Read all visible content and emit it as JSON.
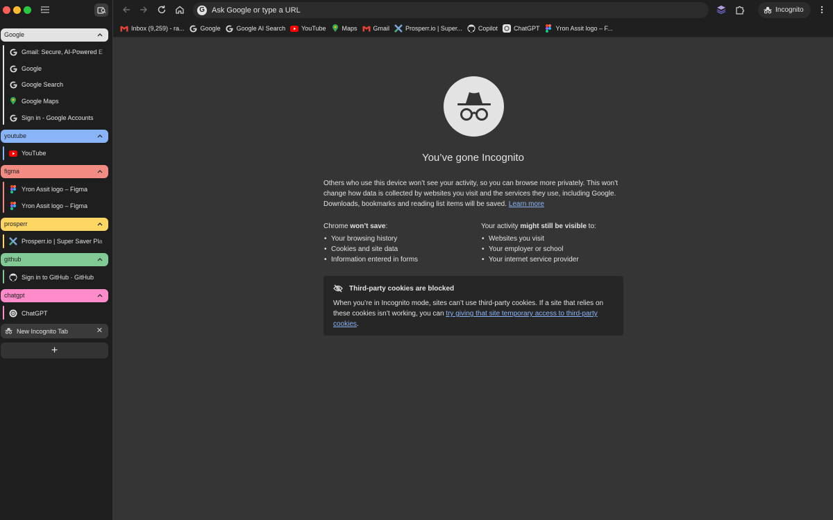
{
  "sidebar": {
    "groups": [
      {
        "label": "Google",
        "color": "#e3e3e3",
        "tabs": [
          {
            "title": "Gmail: Secure, AI-Powered E",
            "icon": "google-icon"
          },
          {
            "title": "Google",
            "icon": "google-icon"
          },
          {
            "title": "Google Search",
            "icon": "google-icon"
          },
          {
            "title": "Google Maps",
            "icon": "maps-icon"
          },
          {
            "title": "Sign in - Google Accounts",
            "icon": "google-icon"
          }
        ]
      },
      {
        "label": "youtube",
        "color": "#8ab4f8",
        "tabs": [
          {
            "title": "YouTube",
            "icon": "youtube-icon"
          }
        ]
      },
      {
        "label": "figma",
        "color": "#f28b82",
        "tabs": [
          {
            "title": "Yron Assit logo – Figma",
            "icon": "figma-icon"
          },
          {
            "title": "Yron Assit logo – Figma",
            "icon": "figma-icon"
          }
        ]
      },
      {
        "label": "prosperr",
        "color": "#fdd663",
        "tabs": [
          {
            "title": "Prosperr.io | Super Saver Pla",
            "icon": "prosperr-icon"
          }
        ]
      },
      {
        "label": "github",
        "color": "#81c995",
        "tabs": [
          {
            "title": "Sign in to GitHub · GitHub",
            "icon": "github-icon"
          }
        ]
      },
      {
        "label": "chatgpt",
        "color": "#ff8bcb",
        "tabs": [
          {
            "title": "ChatGPT",
            "icon": "chatgpt-icon"
          }
        ]
      }
    ],
    "active_tab": {
      "title": "New Incognito Tab",
      "close": "✕"
    },
    "add_tab": "+"
  },
  "toolbar": {
    "omnibox_placeholder": "Ask Google or type a URL",
    "profile_label": "Incognito"
  },
  "bookmarks": [
    {
      "label": "Inbox (9,259) - ra...",
      "icon": "gmail-icon"
    },
    {
      "label": "Google",
      "icon": "google-icon"
    },
    {
      "label": "Google AI Search",
      "icon": "google-icon"
    },
    {
      "label": "YouTube",
      "icon": "youtube-icon"
    },
    {
      "label": "Maps",
      "icon": "maps-icon"
    },
    {
      "label": "Gmail",
      "icon": "gmail-icon"
    },
    {
      "label": "Prosperr.io | Super...",
      "icon": "prosperr-icon"
    },
    {
      "label": "Copilot",
      "icon": "github-icon"
    },
    {
      "label": "ChatGPT",
      "icon": "chatgpt-icon"
    },
    {
      "label": "Yron Assit logo – F...",
      "icon": "figma-icon"
    }
  ],
  "main": {
    "headline": "You’ve gone Incognito",
    "intro": "Others who use this device won’t see your activity, so you can browse more privately. This won’t change how data is collected by websites you visit and the services they use, including Google. Downloads, bookmarks and reading list items will be saved.",
    "learn_more": "Learn more",
    "left_col": {
      "title_prefix": "Chrome ",
      "title_bold": "won’t save",
      "title_suffix": ":",
      "items": [
        "Your browsing history",
        "Cookies and site data",
        "Information entered in forms"
      ]
    },
    "right_col": {
      "title_prefix": "Your activity ",
      "title_bold": "might still be visible",
      "title_suffix": " to:",
      "items": [
        "Websites you visit",
        "Your employer or school",
        "Your internet service provider"
      ]
    },
    "cookies": {
      "title": "Third-party cookies are blocked",
      "body": "When you’re in Incognito mode, sites can’t use third-party cookies. If a site that relies on these cookies isn’t working, you can ",
      "link": "try giving that site temporary access to third-party cookies",
      "end": "."
    }
  },
  "colors": {
    "link": "#8ab4f8",
    "background": "#353535",
    "sidebar": "#1e1e1e",
    "toolbar": "#1f1f1f"
  }
}
